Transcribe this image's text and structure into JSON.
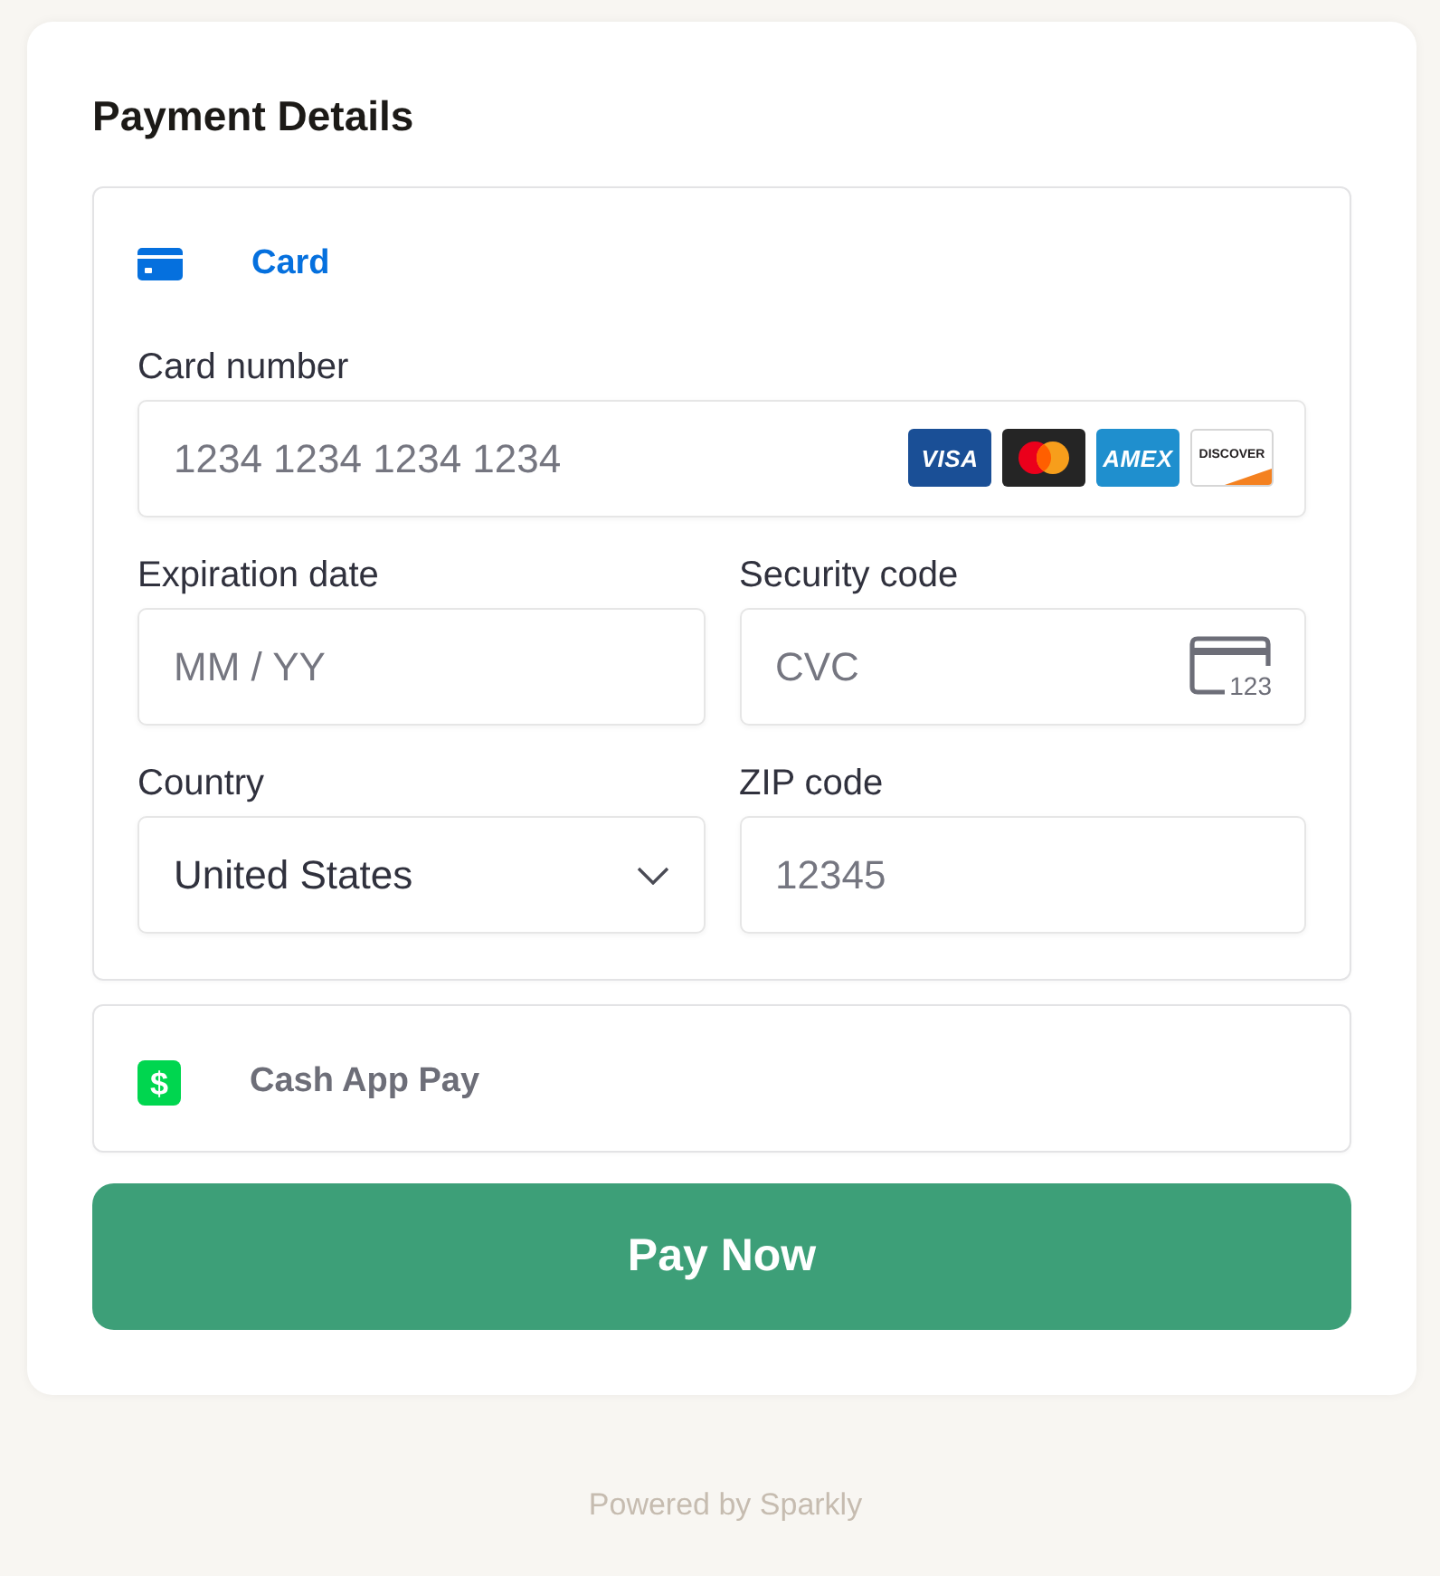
{
  "title": "Payment Details",
  "payment_methods": [
    {
      "kind": "card",
      "label": "Card",
      "selected": true,
      "fields": [
        {
          "kind": "card_number",
          "label": "Card number",
          "placeholder": "1234 1234 1234 1234",
          "brands": [
            {
              "kind": "wordmark",
              "label": "VISA",
              "color": "#1a4f96"
            },
            {
              "kind": "circles",
              "color": "#252525"
            },
            {
              "kind": "wordmark",
              "label": "AMEX",
              "color": "#1f8fce"
            },
            {
              "kind": "corner",
              "label": "DISCOVER",
              "color": "#ffffff"
            }
          ]
        },
        {
          "kind": "text",
          "label": "Expiration date",
          "placeholder": "MM / YY"
        },
        {
          "kind": "cvc",
          "label": "Security code",
          "placeholder": "CVC",
          "icon_text": "123"
        },
        {
          "kind": "select",
          "label": "Country",
          "value": "United States"
        },
        {
          "kind": "text",
          "label": "ZIP code",
          "placeholder": "12345"
        }
      ]
    },
    {
      "kind": "cash",
      "label": "Cash App Pay",
      "selected": false,
      "icon_text": "$"
    }
  ],
  "pay_button": {
    "label": "Pay Now"
  },
  "footer": "Powered by Sparkly"
}
